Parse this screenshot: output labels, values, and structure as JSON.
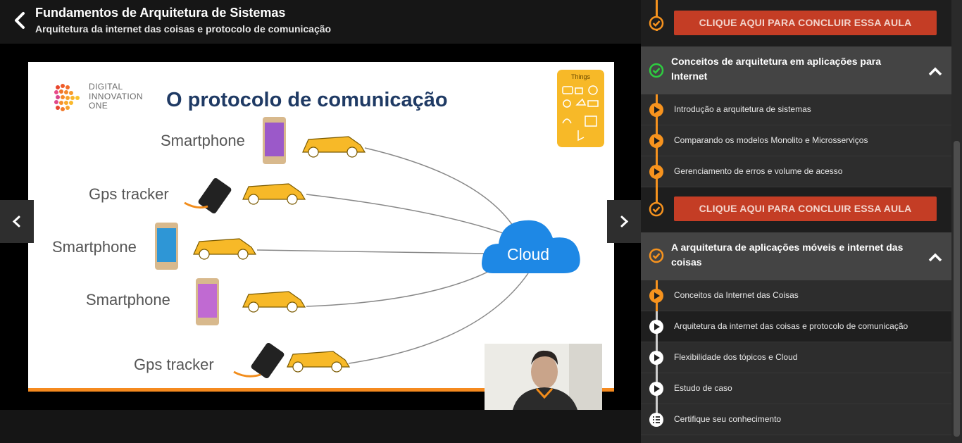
{
  "header": {
    "course_title": "Fundamentos de Arquitetura de Sistemas",
    "lesson_subtitle": "Arquitetura da internet das coisas e protocolo de comunicação"
  },
  "slide": {
    "brand": [
      "DIGITAL",
      "INNOVATION",
      "ONE"
    ],
    "heading": "O protocolo de comunicação",
    "devices": [
      "Smartphone",
      "Gps tracker",
      "Smartphone",
      "Smartphone",
      "Gps tracker"
    ],
    "things_title": "Things",
    "cloud_label": "Cloud"
  },
  "sidebar": {
    "complete_button_label": "CLIQUE AQUI PARA CONCLUIR ESSA AULA",
    "sections": [
      {
        "title": "Conceitos de arquitetura em aplicações para Internet",
        "lessons": [
          "Introdução a arquitetura de sistemas",
          "Comparando os modelos Monolito e Microsserviços",
          "Gerenciamento de erros e volume de acesso"
        ]
      },
      {
        "title": "A arquitetura de aplicações móveis e internet das coisas",
        "lessons": [
          "Conceitos da Internet das Coisas",
          "Arquitetura da internet das coisas e protocolo de comunicação",
          "Flexibilidade dos tópicos e Cloud",
          "Estudo de caso",
          "Certifique seu conhecimento"
        ]
      }
    ]
  },
  "colors": {
    "accent_orange": "#f7931e",
    "complete_red": "#c43d25",
    "check_green": "#2ecc40",
    "slide_heading": "#1f3a64"
  }
}
